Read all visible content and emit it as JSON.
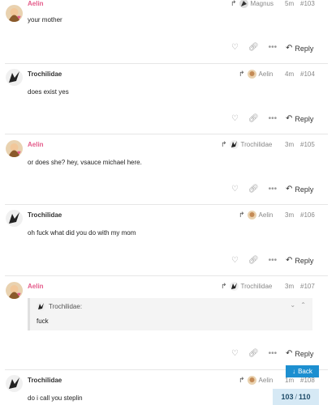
{
  "posts": [
    {
      "user": "Aelin",
      "reply_to": "Magnus",
      "time": "5m",
      "number": "#103",
      "text": "your mother"
    },
    {
      "user": "Trochilidae",
      "reply_to": "Aelin",
      "time": "4m",
      "number": "#104",
      "text": "does exist yes"
    },
    {
      "user": "Aelin",
      "reply_to": "Trochilidae",
      "time": "3m",
      "number": "#105",
      "text": "or does she? hey, vsauce michael here."
    },
    {
      "user": "Trochilidae",
      "reply_to": "Aelin",
      "time": "3m",
      "number": "#106",
      "text": "oh fuck what did you do with my mom"
    },
    {
      "user": "Aelin",
      "reply_to": "Trochilidae",
      "time": "3m",
      "number": "#107",
      "quote_author": "Trochilidae:",
      "quote_text": "fuck"
    },
    {
      "user": "Trochilidae",
      "reply_to": "Aelin",
      "time": "1m",
      "number": "#108",
      "text": "do i call you steplin"
    }
  ],
  "actions": {
    "reply_label": "Reply",
    "like_icon": "heart-outline-icon",
    "link_icon": "link-icon",
    "more_icon": "ellipsis-icon"
  },
  "back_label": "Back",
  "progress": {
    "current": "103",
    "total": "110"
  },
  "colors": {
    "accent": "#1d8fd0",
    "username_pink": "#e45b8a",
    "progress_bg": "#d6e9f5"
  }
}
